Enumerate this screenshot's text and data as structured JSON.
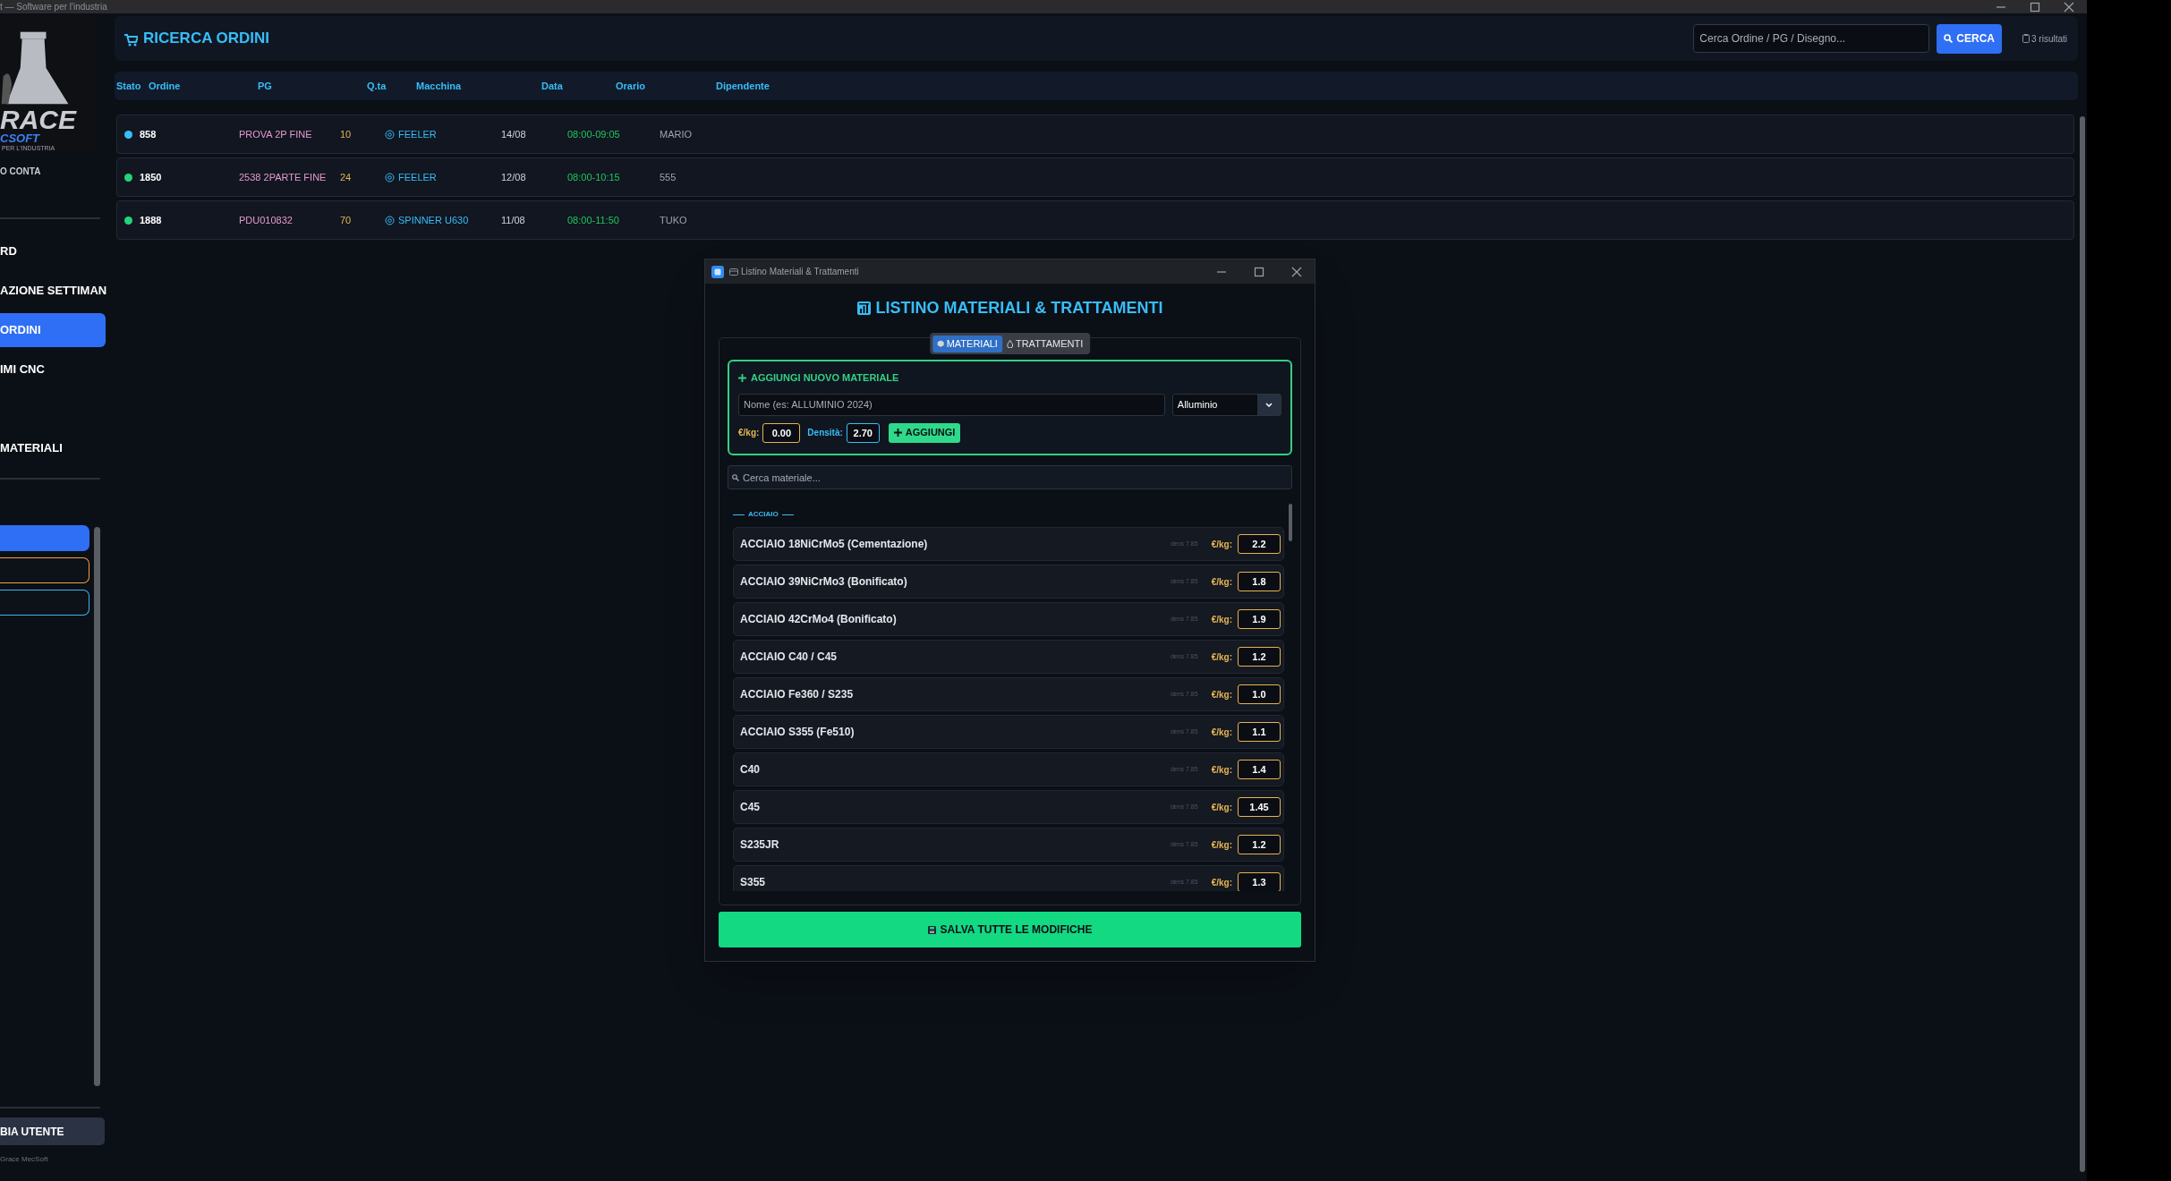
{
  "app_title": "t — Software per l'industria",
  "sidebar": {
    "logo": {
      "name": "RACE",
      "subname": "CSOFT",
      "tagline": "PER L'INDUSTRIA"
    },
    "user": "O CONTA",
    "items": [
      {
        "label": "RD",
        "selected": false
      },
      {
        "label": "AZIONE SETTIMAN",
        "selected": false
      },
      {
        "label": "ORDINI",
        "selected": true
      },
      {
        "label": "IMI CNC",
        "selected": false
      },
      {
        "label": "MATERIALI",
        "selected": false
      }
    ],
    "buttons": [
      {
        "kind": "filled",
        "color": "#2f6ff5"
      },
      {
        "kind": "outline",
        "color": "#f0a03c"
      },
      {
        "kind": "outline",
        "color": "#38b6f0"
      }
    ],
    "change_user": "BIA UTENTE",
    "footer": "Grace MecSoft"
  },
  "header": {
    "title": "RICERCA ORDINI",
    "search_placeholder": "Cerca Ordine / PG / Disegno...",
    "search_button": "CERCA",
    "result_count": "3 risultati"
  },
  "table": {
    "columns": [
      "Stato",
      "Ordine",
      "PG",
      "Q.ta",
      "Macchina",
      "Data",
      "Orario",
      "Dipendente"
    ],
    "rows": [
      {
        "color": "#38bdf8",
        "order": "858",
        "pg": "PROVA 2P FINE",
        "qty": "10",
        "machine": "FEELER",
        "date": "14/08",
        "time": "08:00-09:05",
        "employee": "MARIO"
      },
      {
        "color": "#22d37a",
        "order": "1850",
        "pg": "2538 2PARTE FINE",
        "qty": "24",
        "machine": "FEELER",
        "date": "12/08",
        "time": "08:00-10:15",
        "employee": "555"
      },
      {
        "color": "#22d37a",
        "order": "1888",
        "pg": "PDU010832",
        "qty": "70",
        "machine": "SPINNER U630",
        "date": "11/08",
        "time": "08:00-11:50",
        "employee": "TUKO"
      }
    ]
  },
  "dialog": {
    "window_title": "Listino Materiali & Trattamenti",
    "heading": "LISTINO MATERIALI & TRATTAMENTI",
    "tabs": [
      {
        "label": "MATERIALI",
        "selected": true
      },
      {
        "label": "TRATTAMENTI",
        "selected": false
      }
    ],
    "add_form": {
      "title": "AGGIUNGI NUOVO MATERIALE",
      "name_placeholder": "Nome (es: ALLUMINIO 2024)",
      "category": "Alluminio",
      "price_label": "€/kg:",
      "price": "0.00",
      "density_label": "Densità:",
      "density": "2.70",
      "add_button": "AGGIUNGI"
    },
    "search_placeholder": "Cerca materiale...",
    "group": "ACCIAIO",
    "materials": [
      {
        "name": "ACCIAIO 18NiCrMo5 (Cementazione)",
        "density": "dens 7.85",
        "price_label": "€/kg:",
        "price": "2.2"
      },
      {
        "name": "ACCIAIO 39NiCrMo3 (Bonificato)",
        "density": "dens 7.85",
        "price_label": "€/kg:",
        "price": "1.8"
      },
      {
        "name": "ACCIAIO 42CrMo4 (Bonificato)",
        "density": "dens 7.85",
        "price_label": "€/kg:",
        "price": "1.9"
      },
      {
        "name": "ACCIAIO C40 / C45",
        "density": "dens 7.85",
        "price_label": "€/kg:",
        "price": "1.2"
      },
      {
        "name": "ACCIAIO Fe360 / S235",
        "density": "dens 7.85",
        "price_label": "€/kg:",
        "price": "1.0"
      },
      {
        "name": "ACCIAIO S355 (Fe510)",
        "density": "dens 7.85",
        "price_label": "€/kg:",
        "price": "1.1"
      },
      {
        "name": "C40",
        "density": "dens 7.85",
        "price_label": "€/kg:",
        "price": "1.4"
      },
      {
        "name": "C45",
        "density": "dens 7.85",
        "price_label": "€/kg:",
        "price": "1.45"
      },
      {
        "name": "S235JR",
        "density": "dens 7.85",
        "price_label": "€/kg:",
        "price": "1.2"
      },
      {
        "name": "S355",
        "density": "dens 7.85",
        "price_label": "€/kg:",
        "price": "1.3"
      }
    ],
    "save_button": "SALVA TUTTE LE MODIFICHE"
  }
}
